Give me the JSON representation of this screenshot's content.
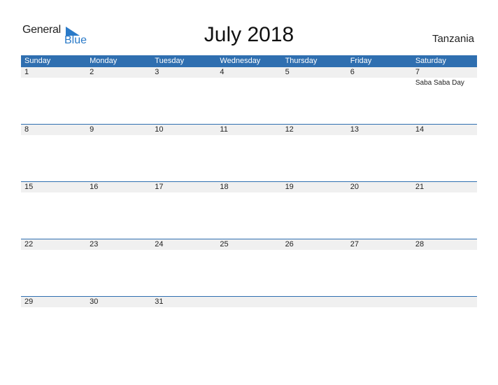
{
  "logo": {
    "line1": "General",
    "line2": "Blue"
  },
  "title": "July 2018",
  "country": "Tanzania",
  "days": [
    "Sunday",
    "Monday",
    "Tuesday",
    "Wednesday",
    "Thursday",
    "Friday",
    "Saturday"
  ],
  "weeks": [
    {
      "dates": [
        "1",
        "2",
        "3",
        "4",
        "5",
        "6",
        "7"
      ],
      "events": [
        "",
        "",
        "",
        "",
        "",
        "",
        "Saba Saba Day"
      ]
    },
    {
      "dates": [
        "8",
        "9",
        "10",
        "11",
        "12",
        "13",
        "14"
      ],
      "events": [
        "",
        "",
        "",
        "",
        "",
        "",
        ""
      ]
    },
    {
      "dates": [
        "15",
        "16",
        "17",
        "18",
        "19",
        "20",
        "21"
      ],
      "events": [
        "",
        "",
        "",
        "",
        "",
        "",
        ""
      ]
    },
    {
      "dates": [
        "22",
        "23",
        "24",
        "25",
        "26",
        "27",
        "28"
      ],
      "events": [
        "",
        "",
        "",
        "",
        "",
        "",
        ""
      ]
    },
    {
      "dates": [
        "29",
        "30",
        "31",
        "",
        "",
        "",
        ""
      ],
      "events": [
        "",
        "",
        "",
        "",
        "",
        "",
        ""
      ]
    }
  ]
}
